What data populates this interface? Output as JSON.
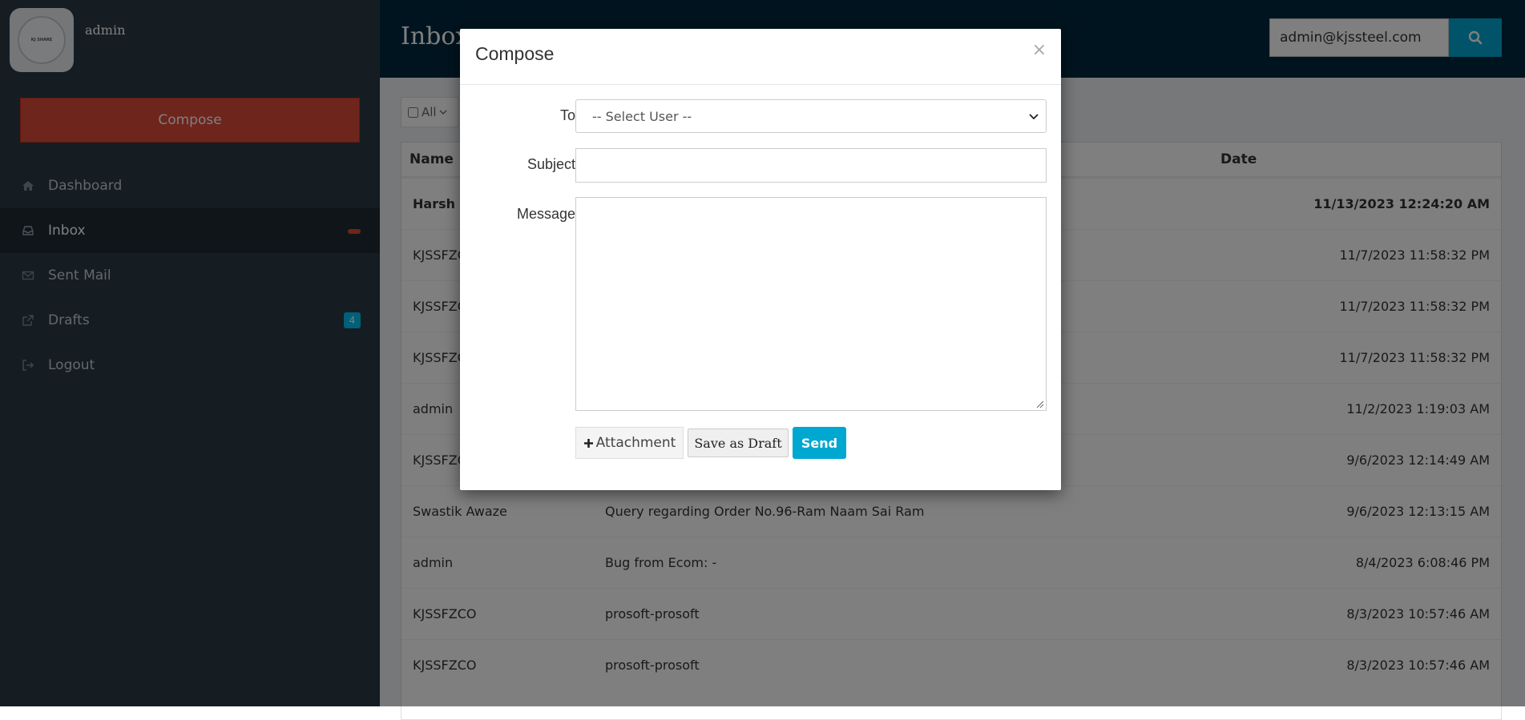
{
  "sidebar": {
    "username": "admin",
    "avatar_text": "KJ SHARE",
    "compose_label": "Compose",
    "items": [
      {
        "label": "Dashboard",
        "icon": "home-icon"
      },
      {
        "label": "Inbox",
        "icon": "inbox-icon",
        "badge": ""
      },
      {
        "label": "Sent Mail",
        "icon": "envelope-icon"
      },
      {
        "label": "Drafts",
        "icon": "external-link-icon",
        "badge": "4"
      },
      {
        "label": "Logout",
        "icon": "sign-out-icon"
      }
    ]
  },
  "header": {
    "title": "Inbox",
    "search_value": "admin@kjssteel.com"
  },
  "toolbar": {
    "select_all_label": "All"
  },
  "table": {
    "columns": {
      "name": "Name",
      "date": "Date"
    },
    "rows": [
      {
        "name": "Harsh",
        "subject": "",
        "date": "11/13/2023 12:24:20 AM",
        "unread": true
      },
      {
        "name": "KJSSFZCO",
        "subject": "",
        "date": "11/7/2023 11:58:32 PM"
      },
      {
        "name": "KJSSFZCO",
        "subject": "",
        "date": "11/7/2023 11:58:32 PM"
      },
      {
        "name": "KJSSFZCO",
        "subject": "",
        "date": "11/7/2023 11:58:32 PM"
      },
      {
        "name": "admin",
        "subject": "",
        "date": "11/2/2023 1:19:03 AM"
      },
      {
        "name": "KJSSFZCO",
        "subject": "",
        "date": "9/6/2023 12:14:49 AM"
      },
      {
        "name": "Swastik Awaze",
        "subject": "Query regarding Order No.96-Ram Naam Sai Ram",
        "date": "9/6/2023 12:13:15 AM"
      },
      {
        "name": "admin",
        "subject": "Bug from Ecom: -",
        "date": "8/4/2023 6:08:46 PM"
      },
      {
        "name": "KJSSFZCO",
        "subject": "prosoft-prosoft",
        "date": "8/3/2023 10:57:46 AM"
      },
      {
        "name": "KJSSFZCO",
        "subject": "prosoft-prosoft",
        "date": "8/3/2023 10:57:46 AM"
      }
    ]
  },
  "modal": {
    "title": "Compose",
    "close": "×",
    "to_label": "To",
    "to_value": "-- Select User --",
    "subject_label": "Subject",
    "subject_value": "",
    "message_label": "Message",
    "message_value": "",
    "attachment_label": "Attachment",
    "draft_label": "Save as Draft",
    "send_label": "Send"
  }
}
